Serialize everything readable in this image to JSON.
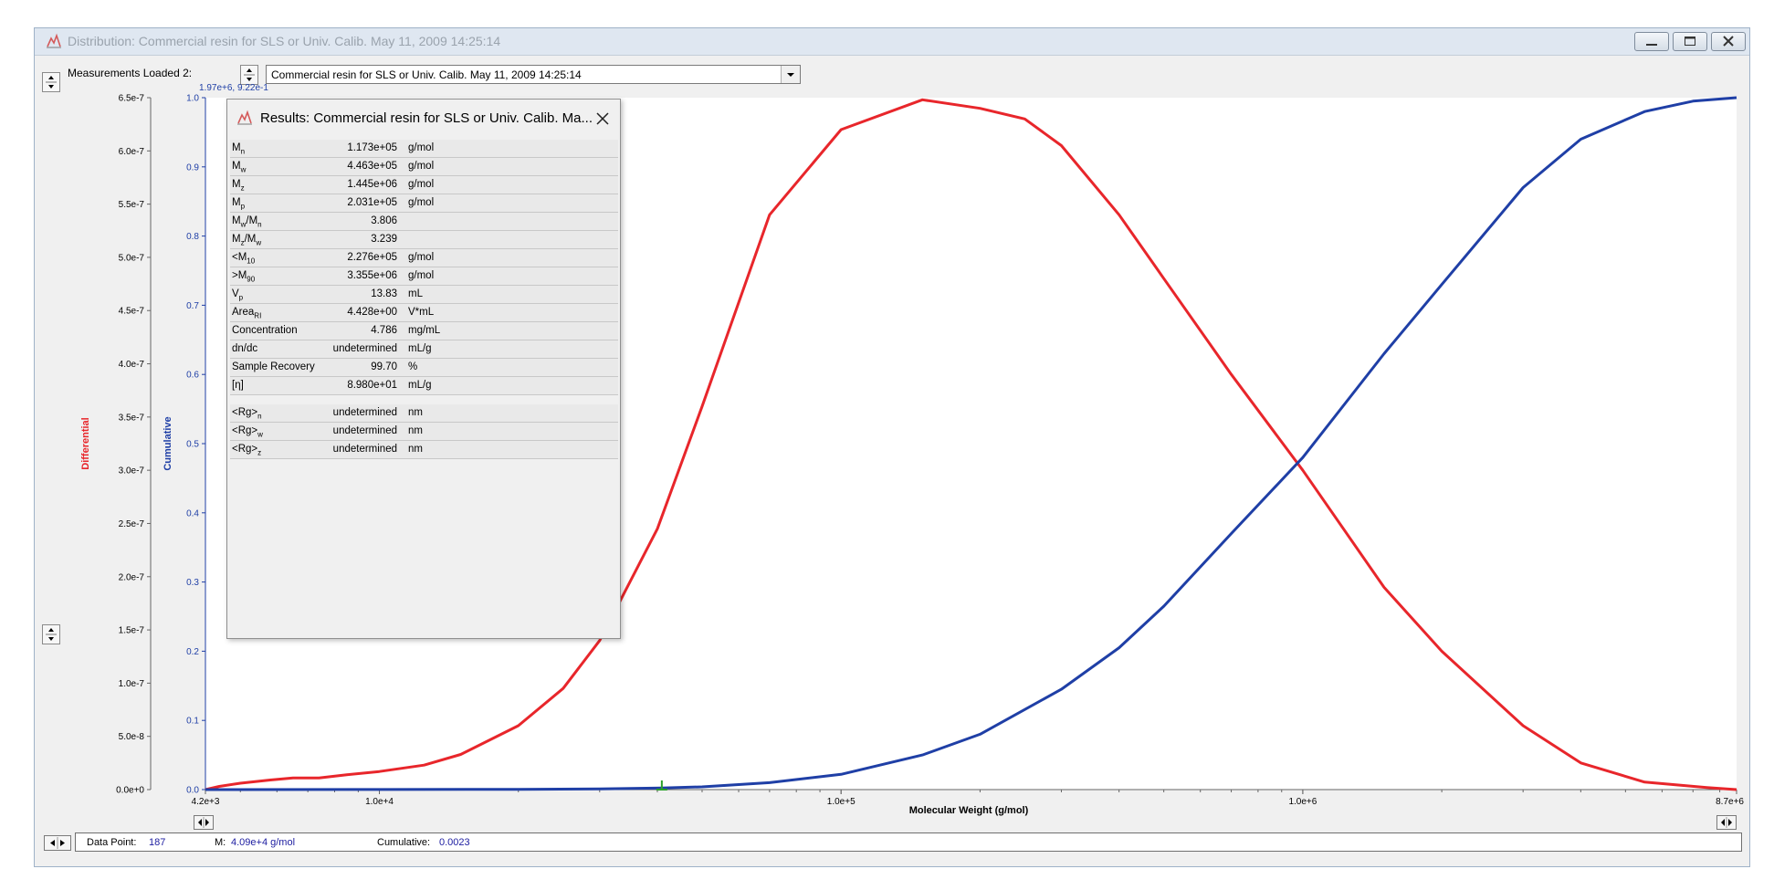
{
  "window": {
    "title": "Distribution: Commercial resin for SLS or Univ. Calib.  May 11, 2009  14:25:14"
  },
  "measurements": {
    "label": "Measurements Loaded 2:",
    "selected": "Commercial resin for SLS or Univ. Calib.  May 11, 2009  14:25:14"
  },
  "chart_data": {
    "type": "line",
    "cursor_readout": "1.97e+6, 9.22e-1",
    "xlabel": "Molecular Weight (g/mol)",
    "xscale": "log",
    "xlim": [
      4200,
      8700000
    ],
    "x_ticks": [
      "4.2e+3",
      "1.0e+4",
      "1.0e+5",
      "1.0e+6",
      "8.7e+6"
    ],
    "ylabel_left": "Differential",
    "ylim_left": [
      0,
      6.5e-07
    ],
    "y_ticks_left": [
      "0.0e+0",
      "5.0e-8",
      "1.0e-7",
      "1.5e-7",
      "2.0e-7",
      "2.5e-7",
      "3.0e-7",
      "3.5e-7",
      "4.0e-7",
      "4.5e-7",
      "5.0e-7",
      "5.5e-7",
      "6.0e-7",
      "6.5e-7"
    ],
    "ylabel_right": "Cumulative",
    "ylim_right": [
      0,
      1.0
    ],
    "y_ticks_right": [
      "0.0",
      "0.1",
      "0.2",
      "0.3",
      "0.4",
      "0.5",
      "0.6",
      "0.7",
      "0.8",
      "0.9",
      "1.0"
    ],
    "marker_x": 40900,
    "series": [
      {
        "name": "Differential",
        "axis": "left",
        "color": "#e8262b",
        "x": [
          4200,
          4500,
          5000,
          5800,
          6500,
          7400,
          8500,
          10000,
          12500,
          15000,
          20000,
          25000,
          30000,
          40000,
          50000,
          70000,
          100000,
          150000,
          200000,
          250000,
          300000,
          400000,
          500000,
          700000,
          1000000,
          1500000,
          2000000,
          3000000,
          4000000,
          5500000,
          7500000,
          8700000
        ],
        "values": [
          0,
          3e-09,
          6e-09,
          9e-09,
          1.1e-08,
          1.1e-08,
          1.4e-08,
          1.7e-08,
          2.3e-08,
          3.3e-08,
          6e-08,
          9.5e-08,
          1.4e-07,
          2.45e-07,
          3.6e-07,
          5.4e-07,
          6.2e-07,
          6.48e-07,
          6.4e-07,
          6.3e-07,
          6.05e-07,
          5.4e-07,
          4.8e-07,
          3.9e-07,
          3e-07,
          1.9e-07,
          1.3e-07,
          6e-08,
          2.5e-08,
          7e-09,
          2e-09,
          0
        ]
      },
      {
        "name": "Cumulative",
        "axis": "right",
        "color": "#1f3fa6",
        "x": [
          4200,
          10000,
          20000,
          30000,
          40900,
          50000,
          70000,
          100000,
          150000,
          200000,
          300000,
          400000,
          500000,
          700000,
          1000000,
          1500000,
          2000000,
          3000000,
          4000000,
          5500000,
          7000000,
          8700000
        ],
        "values": [
          0,
          0.0001,
          0.0004,
          0.0011,
          0.0023,
          0.004,
          0.01,
          0.022,
          0.05,
          0.08,
          0.145,
          0.205,
          0.265,
          0.37,
          0.48,
          0.63,
          0.73,
          0.87,
          0.94,
          0.98,
          0.995,
          1.0
        ]
      }
    ]
  },
  "results": {
    "title": "Results: Commercial resin for SLS or Univ. Calib.  Ma...",
    "rows": [
      {
        "label": "M",
        "sub": "n",
        "value": "1.173e+05",
        "unit": "g/mol"
      },
      {
        "label": "M",
        "sub": "w",
        "value": "4.463e+05",
        "unit": "g/mol"
      },
      {
        "label": "M",
        "sub": "z",
        "value": "1.445e+06",
        "unit": "g/mol"
      },
      {
        "label": "M",
        "sub": "p",
        "value": "2.031e+05",
        "unit": "g/mol"
      },
      {
        "label": "M",
        "sub": "w",
        "label2": "/M",
        "sub2": "n",
        "value": "3.806",
        "unit": ""
      },
      {
        "label": "M",
        "sub": "z",
        "label2": "/M",
        "sub2": "w",
        "value": "3.239",
        "unit": ""
      },
      {
        "label": "<M",
        "sub": "10",
        "value": "2.276e+05",
        "unit": "g/mol"
      },
      {
        "label": ">M",
        "sub": "90",
        "value": "3.355e+06",
        "unit": "g/mol"
      },
      {
        "label": "V",
        "sub": "p",
        "value": "13.83",
        "unit": "mL"
      },
      {
        "label": "Area",
        "sub": "RI",
        "value": "4.428e+00",
        "unit": "V*mL"
      },
      {
        "label": "Concentration",
        "sub": "",
        "value": "4.786",
        "unit": "mg/mL"
      },
      {
        "label": "dn/dc",
        "sub": "",
        "value": "undetermined",
        "unit": "mL/g"
      },
      {
        "label": "Sample Recovery",
        "sub": "",
        "value": "99.70",
        "unit": "%"
      },
      {
        "label": "[η]",
        "sub": "",
        "value": "8.980e+01",
        "unit": "mL/g"
      },
      {
        "gap": true
      },
      {
        "label": "<Rg>",
        "sub": "n",
        "value": "undetermined",
        "unit": "nm"
      },
      {
        "label": "<Rg>",
        "sub": "w",
        "value": "undetermined",
        "unit": "nm"
      },
      {
        "label": "<Rg>",
        "sub": "z",
        "value": "undetermined",
        "unit": "nm"
      }
    ]
  },
  "status": {
    "data_point_label": "Data Point:",
    "data_point_value": "187",
    "m_label": "M:",
    "m_value": "4.09e+4 g/mol",
    "cumulative_label": "Cumulative:",
    "cumulative_value": "0.0023"
  },
  "icons": {
    "title": "distribution-chart-icon",
    "results": "distribution-chart-icon",
    "close": "close-icon"
  }
}
